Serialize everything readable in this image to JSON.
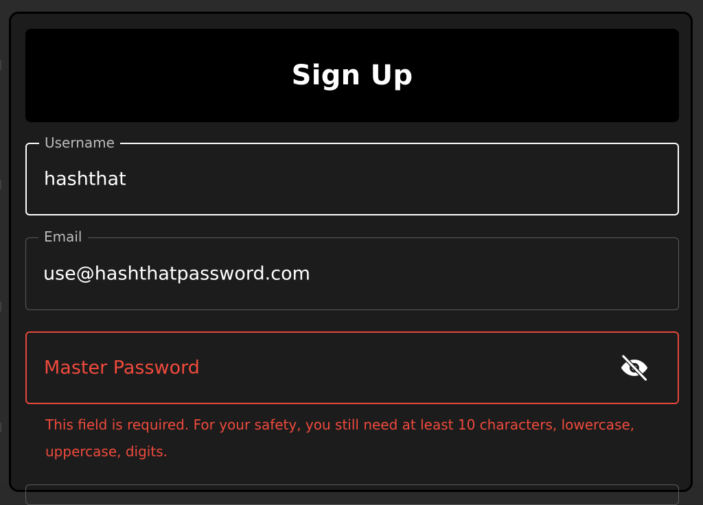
{
  "dialog": {
    "title": "Sign Up"
  },
  "form": {
    "username": {
      "label": "Username",
      "value": "hashthat"
    },
    "email": {
      "label": "Email",
      "value": "use@hashthatpassword.com"
    },
    "master_password": {
      "placeholder": "Master Password",
      "visibility_icon": "eye-off-icon",
      "error": "This field is required. For your safety, you still need at least 10 characters, lowercase, uppercase, digits."
    }
  },
  "colors": {
    "background": "#1c1c1c",
    "header_background": "#000000",
    "error": "#ef4a3c",
    "focused_border": "#ffffff",
    "default_border": "#5b5b5b"
  }
}
